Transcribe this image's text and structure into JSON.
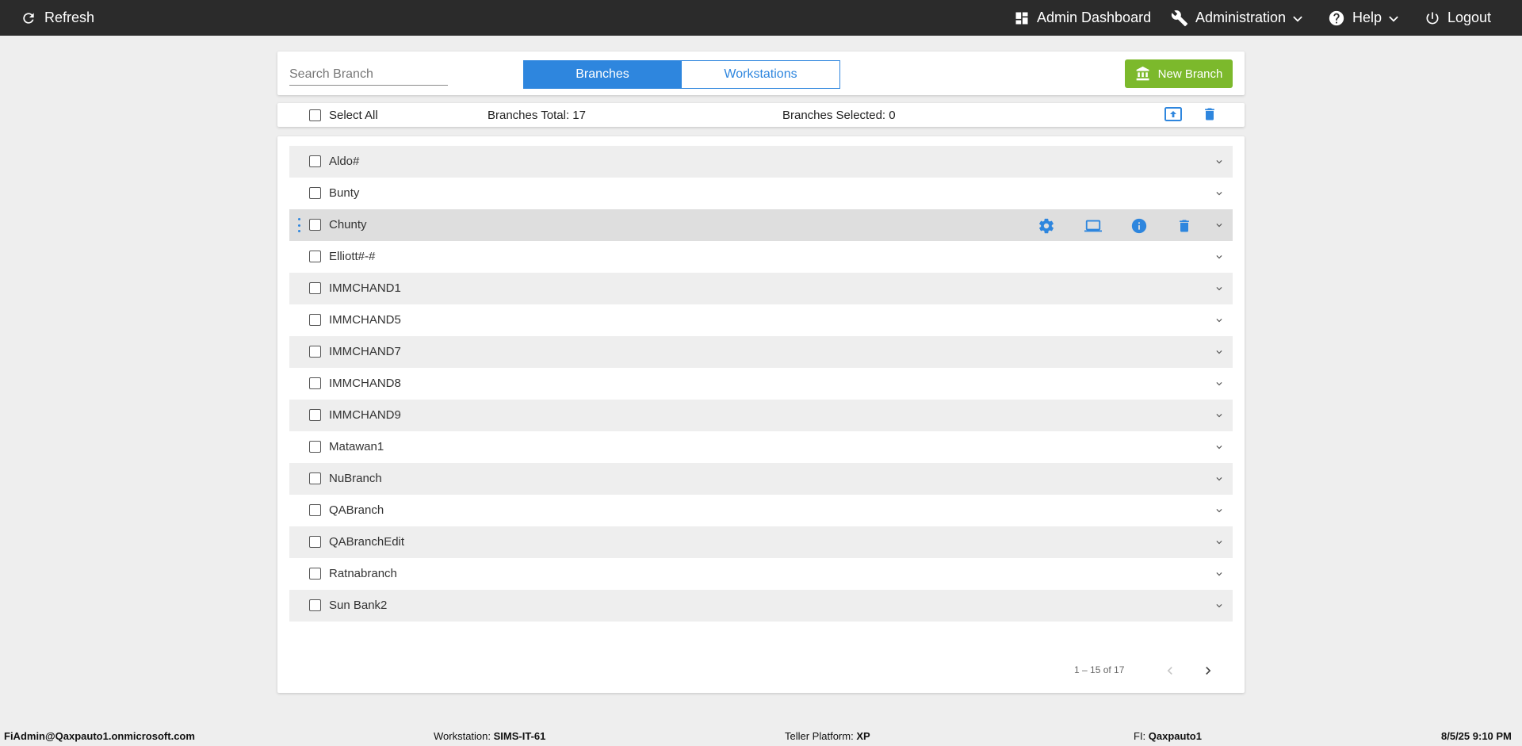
{
  "topbar": {
    "refresh_label": "Refresh",
    "admin_dashboard_label": "Admin Dashboard",
    "administration_label": "Administration",
    "help_label": "Help",
    "logout_label": "Logout"
  },
  "toolbar": {
    "search_placeholder": "Search Branch",
    "tab_branches": "Branches",
    "tab_workstations": "Workstations",
    "active_tab": "Branches",
    "new_branch_label": "New Branch"
  },
  "selection": {
    "select_all_label": "Select All",
    "total_label": "Branches Total: 17",
    "selected_label": "Branches Selected: 0"
  },
  "branches": [
    {
      "name": "Aldo#"
    },
    {
      "name": "Bunty"
    },
    {
      "name": "Chunty"
    },
    {
      "name": "Elliott#-#"
    },
    {
      "name": "IMMCHAND1"
    },
    {
      "name": "IMMCHAND5"
    },
    {
      "name": "IMMCHAND7"
    },
    {
      "name": "IMMCHAND8"
    },
    {
      "name": "IMMCHAND9"
    },
    {
      "name": "Matawan1"
    },
    {
      "name": "NuBranch"
    },
    {
      "name": "QABranch"
    },
    {
      "name": "QABranchEdit"
    },
    {
      "name": "Ratnabranch"
    },
    {
      "name": "Sun Bank2"
    }
  ],
  "hovered_row": "Chunty",
  "pagination": {
    "range_label": "1 – 15 of 17"
  },
  "footer": {
    "user": "FiAdmin@Qaxpauto1.onmicrosoft.com",
    "workstation_label": "Workstation:",
    "workstation_value": "SIMS-IT-61",
    "platform_label": "Teller Platform:",
    "platform_value": "XP",
    "fi_label": "FI:",
    "fi_value": "Qaxpauto1",
    "datetime": "8/5/25 9:10 PM"
  },
  "colors": {
    "topbar": "#2b2b2b",
    "accent": "#2e86de",
    "new_branch": "#7cb92c",
    "background": "#eeeeee"
  }
}
